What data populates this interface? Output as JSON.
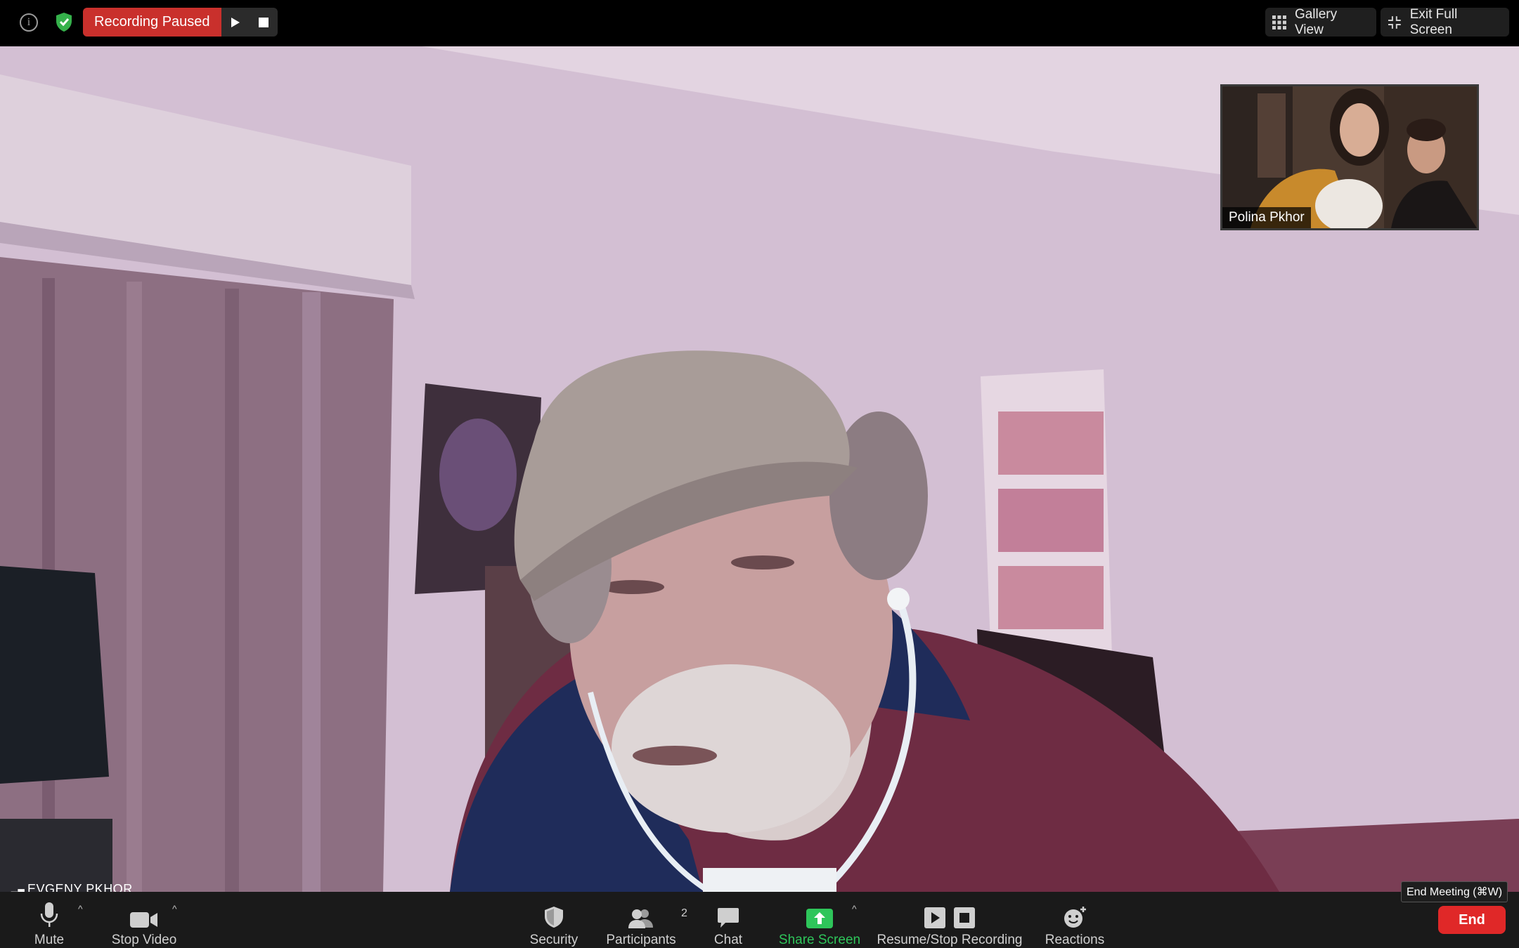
{
  "topbar": {
    "recording_status": "Recording Paused",
    "gallery_view_label": "Gallery View",
    "exit_fullscreen_label": "Exit Full Screen"
  },
  "main_video": {
    "participant_name": "EVGENY PKHOR"
  },
  "self_view": {
    "participant_name": "Polina Pkhor"
  },
  "toolbar": {
    "mute_label": "Mute",
    "stop_video_label": "Stop Video",
    "security_label": "Security",
    "participants_label": "Participants",
    "participants_count": "2",
    "chat_label": "Chat",
    "share_screen_label": "Share Screen",
    "recording_label": "Resume/Stop Recording",
    "reactions_label": "Reactions",
    "end_tooltip": "End Meeting (⌘W)",
    "end_label": "End"
  },
  "colors": {
    "recording_red": "#c9302c",
    "share_green": "#2ec55a",
    "end_red": "#e02828",
    "shield_green": "#35b14b"
  },
  "icons": [
    "info-icon",
    "shield-icon",
    "play-icon",
    "stop-icon",
    "grid-icon",
    "exit-fullscreen-icon",
    "microphone-icon",
    "camera-icon",
    "security-shield-icon",
    "participants-icon",
    "chat-bubble-icon",
    "share-screen-icon",
    "reactions-icon"
  ]
}
